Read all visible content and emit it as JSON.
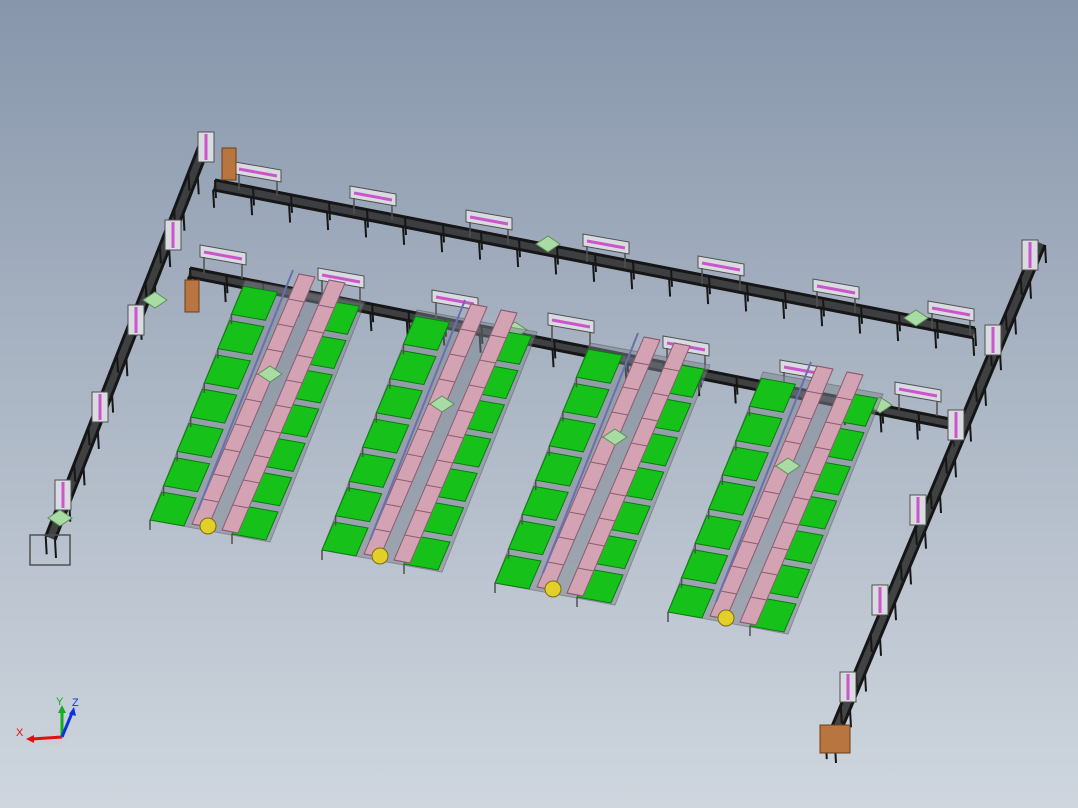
{
  "viewport": {
    "background_top": "#8796ab",
    "background_bottom": "#cfd6de"
  },
  "colors": {
    "conveyor": "#161616",
    "rail": "#2c2c2c",
    "frame": "#505050",
    "station_green": "#16c21a",
    "station_green_dark": "#0b7a10",
    "rack_pink": "#d3a3b4",
    "rack_pink_dark": "#8a5c6f",
    "fixture_magenta": "#cc55cc",
    "transfer_pad": "#a9dca4",
    "lift_orange": "#b8753f",
    "fixture_yellow": "#e3cf2a"
  },
  "assembly_lines": [
    {
      "id": "line-1"
    },
    {
      "id": "line-2"
    },
    {
      "id": "line-3"
    },
    {
      "id": "line-4"
    }
  ],
  "axis_triad": {
    "x_label": "X",
    "y_label": "Y",
    "z_label": "Z",
    "x_color": "#e01010",
    "y_color": "#10b020",
    "z_color": "#1030e0"
  }
}
